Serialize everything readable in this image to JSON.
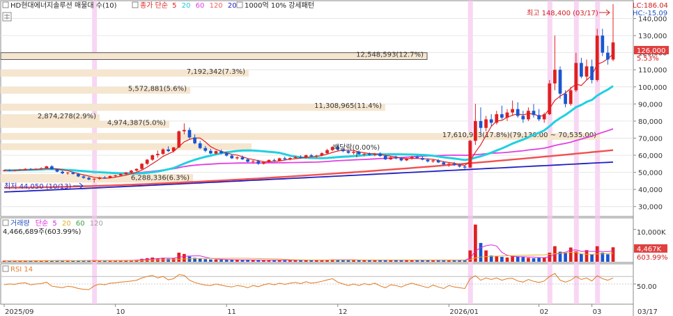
{
  "header": {
    "stock_title": "HD현대에너지솔루션 매물대 수(10)",
    "ma_label": "종가 단순",
    "ma_periods": [
      "5",
      "20",
      "60",
      "120",
      "200"
    ],
    "ma_colors": [
      "#e02020",
      "#20c8d8",
      "#e040e0",
      "#f06060",
      "#2020c0"
    ],
    "vp_label": "1000억 10% 강세패턴",
    "lc_label": "LC:186.04",
    "hc_label": "HC:-15.09"
  },
  "price_axis": {
    "ticks": [
      "140,000",
      "130,000",
      "120,000",
      "110,000",
      "100,000",
      "90,000",
      "80,000",
      "70,000",
      "60,000",
      "50,000",
      "40,000",
      "30,000"
    ],
    "current_price": "126,000",
    "current_change": "5.53%"
  },
  "annotations": {
    "high": "최고 148,400 (03/17)",
    "low": "최저 44,050 (10/13)",
    "dividend": "배당락(0.00%)"
  },
  "volume_panel": {
    "title_prefix": "거래량",
    "ma_label": "단순",
    "ma_periods": [
      "5",
      "20",
      "60",
      "120"
    ],
    "ma_colors": [
      "#e020e0",
      "#e0b020",
      "#40a040",
      "#a0a0a0"
    ],
    "last_volume": "4,466,689주(603.99%)",
    "axis_tick": "10,000K",
    "current_value": "4,467K",
    "current_pct": "603.99%"
  },
  "rsi_panel": {
    "title": "RSI 14",
    "axis_tick": "50.00"
  },
  "x_axis": {
    "labels": [
      "2025/09",
      "10",
      "11",
      "12",
      "2026/01",
      "02",
      "03",
      "03/17"
    ]
  },
  "chart_data": {
    "type": "candlestick",
    "ylim": [
      25000,
      150000
    ],
    "high_point": {
      "value": 148400,
      "date": "03/17"
    },
    "low_point": {
      "value": 44050,
      "date": "10/13"
    },
    "volume_profile": [
      {
        "label": "12,548,593(12.7%)",
        "low": 116000,
        "high": 120000,
        "highlight": true
      },
      {
        "label": "7,192,342(7.3%)",
        "low": 106000,
        "high": 110000
      },
      {
        "label": "5,572,881(5.6%)",
        "low": 96000,
        "high": 100000
      },
      {
        "label": "11,308,965(11.4%)",
        "low": 86000,
        "high": 90000
      },
      {
        "label": "2,874,278(2.9%)",
        "low": 80000,
        "high": 84000
      },
      {
        "label": "4,974,387(5.0%)",
        "low": 76000,
        "high": 80000
      },
      {
        "label": "17,610,923(17.8%)(79,130.00 ~ 70,535.00)",
        "low": 69000,
        "high": 73000
      },
      {
        "label": "",
        "low": 63000,
        "high": 67000
      },
      {
        "label": "6,288,336(6.3%)",
        "low": 44000,
        "high": 49000
      }
    ],
    "candles": [
      [
        51000,
        51500,
        50500,
        51200
      ],
      [
        51200,
        51800,
        50800,
        51000
      ],
      [
        51000,
        51600,
        50600,
        51400
      ],
      [
        51400,
        52000,
        51000,
        51600
      ],
      [
        51600,
        52400,
        51200,
        52000
      ],
      [
        52000,
        52500,
        51500,
        51700
      ],
      [
        51700,
        52300,
        51300,
        52000
      ],
      [
        52000,
        53000,
        51600,
        52400
      ],
      [
        52400,
        53800,
        52000,
        53500
      ],
      [
        53500,
        54200,
        51500,
        51800
      ],
      [
        51800,
        52200,
        50000,
        50400
      ],
      [
        50400,
        51000,
        49000,
        49400
      ],
      [
        49400,
        50200,
        48600,
        49800
      ],
      [
        49800,
        50400,
        48800,
        49000
      ],
      [
        49000,
        49600,
        47200,
        47600
      ],
      [
        47600,
        48200,
        46200,
        46800
      ],
      [
        46800,
        47400,
        45400,
        45800
      ],
      [
        45800,
        46600,
        44050,
        46200
      ],
      [
        46200,
        47400,
        45600,
        47000
      ],
      [
        47000,
        47800,
        46400,
        46800
      ],
      [
        46800,
        48200,
        46400,
        47800
      ],
      [
        47800,
        48600,
        47200,
        48200
      ],
      [
        48200,
        49400,
        47800,
        49000
      ],
      [
        49000,
        50200,
        48400,
        49800
      ],
      [
        49800,
        51400,
        49400,
        51000
      ],
      [
        51000,
        52400,
        50400,
        52000
      ],
      [
        52000,
        55400,
        51600,
        55000
      ],
      [
        55000,
        57800,
        54200,
        57400
      ],
      [
        57400,
        60400,
        56800,
        60000
      ],
      [
        60000,
        62800,
        58600,
        60800
      ],
      [
        60800,
        64200,
        60200,
        63400
      ],
      [
        63400,
        65200,
        61800,
        62400
      ],
      [
        62400,
        64800,
        61600,
        64600
      ],
      [
        64600,
        74400,
        64200,
        74000
      ],
      [
        74000,
        78600,
        72200,
        74800
      ],
      [
        74800,
        76200,
        69400,
        70400
      ],
      [
        70400,
        72200,
        66400,
        67000
      ],
      [
        67000,
        68400,
        63600,
        64200
      ],
      [
        64200,
        65400,
        61800,
        62600
      ],
      [
        62600,
        63800,
        60600,
        61000
      ],
      [
        61000,
        62800,
        60400,
        62400
      ],
      [
        62400,
        63400,
        60600,
        61200
      ],
      [
        61200,
        62000,
        59200,
        59800
      ],
      [
        59800,
        60600,
        57800,
        58200
      ],
      [
        58200,
        59400,
        57400,
        58800
      ],
      [
        58800,
        59800,
        57200,
        57600
      ],
      [
        57600,
        58400,
        55800,
        56200
      ],
      [
        56200,
        57200,
        55000,
        56600
      ],
      [
        56600,
        57400,
        54400,
        55000
      ],
      [
        55000,
        56400,
        54600,
        56000
      ],
      [
        56000,
        57600,
        55600,
        57200
      ],
      [
        57200,
        58000,
        56200,
        56800
      ],
      [
        56800,
        58600,
        56400,
        58200
      ],
      [
        58200,
        59200,
        57000,
        57600
      ],
      [
        57600,
        58800,
        57000,
        58400
      ],
      [
        58400,
        59600,
        57800,
        59000
      ],
      [
        59000,
        60000,
        58000,
        58600
      ],
      [
        58600,
        60400,
        58200,
        60000
      ],
      [
        60000,
        60800,
        58800,
        59400
      ],
      [
        59400,
        60200,
        58400,
        59800
      ],
      [
        59800,
        61800,
        59400,
        61200
      ],
      [
        61200,
        63800,
        60800,
        63000
      ],
      [
        63000,
        65400,
        62400,
        64800
      ],
      [
        64800,
        66000,
        62800,
        63400
      ],
      [
        63400,
        64600,
        61800,
        62400
      ],
      [
        62400,
        63400,
        60800,
        61400
      ],
      [
        61400,
        62600,
        60400,
        62000
      ],
      [
        62000,
        62800,
        60000,
        60600
      ],
      [
        60600,
        61400,
        59400,
        60800
      ],
      [
        60800,
        61600,
        59800,
        60200
      ],
      [
        60200,
        61400,
        59400,
        61000
      ],
      [
        61000,
        61800,
        59000,
        59600
      ],
      [
        59600,
        60400,
        57200,
        57600
      ],
      [
        57600,
        59200,
        57200,
        58800
      ],
      [
        58800,
        59800,
        57600,
        58200
      ],
      [
        58200,
        59000,
        56400,
        57000
      ],
      [
        57000,
        58400,
        56600,
        58000
      ],
      [
        58000,
        59600,
        57400,
        59000
      ],
      [
        59000,
        59800,
        57800,
        58400
      ],
      [
        58400,
        59400,
        57000,
        57400
      ],
      [
        57400,
        58200,
        55800,
        56400
      ],
      [
        56400,
        57600,
        55600,
        57000
      ],
      [
        57000,
        57800,
        55400,
        55800
      ],
      [
        55800,
        56600,
        54000,
        54600
      ],
      [
        54600,
        55600,
        53200,
        55000
      ],
      [
        55000,
        56200,
        53800,
        54200
      ],
      [
        54200,
        55000,
        52800,
        53400
      ],
      [
        53400,
        54200,
        51800,
        52800
      ],
      [
        52800,
        69000,
        52600,
        68400
      ],
      [
        68400,
        90000,
        66000,
        80000
      ],
      [
        80000,
        88000,
        73000,
        76000
      ],
      [
        76000,
        83000,
        74000,
        81000
      ],
      [
        81000,
        84000,
        77000,
        79000
      ],
      [
        79000,
        86000,
        78000,
        84000
      ],
      [
        84000,
        89000,
        81000,
        82000
      ],
      [
        82000,
        87000,
        80000,
        85000
      ],
      [
        85000,
        92000,
        83000,
        87000
      ],
      [
        87000,
        91000,
        82000,
        83000
      ],
      [
        83000,
        86000,
        79000,
        81000
      ],
      [
        81000,
        88000,
        80000,
        86000
      ],
      [
        86000,
        90000,
        82000,
        83500
      ],
      [
        83500,
        87000,
        80000,
        81000
      ],
      [
        81000,
        85000,
        79000,
        84000
      ],
      [
        84000,
        104000,
        83500,
        102000
      ],
      [
        102000,
        130000,
        98000,
        110000
      ],
      [
        110000,
        112000,
        93000,
        96000
      ],
      [
        96000,
        98000,
        88000,
        90000
      ],
      [
        90000,
        100000,
        89000,
        98000
      ],
      [
        98000,
        120000,
        97000,
        114000
      ],
      [
        114000,
        117000,
        105000,
        106000
      ],
      [
        106000,
        116000,
        104000,
        112000
      ],
      [
        112000,
        116000,
        102000,
        104000
      ],
      [
        104000,
        134000,
        103000,
        130000
      ],
      [
        130000,
        134000,
        118000,
        120000
      ],
      [
        120000,
        124000,
        113000,
        116000
      ],
      [
        116000,
        148400,
        115000,
        126000
      ]
    ],
    "volumes": [
      300,
      280,
      310,
      290,
      350,
      320,
      300,
      340,
      400,
      380,
      360,
      340,
      320,
      330,
      380,
      360,
      400,
      450,
      360,
      330,
      380,
      360,
      420,
      460,
      520,
      580,
      900,
      1100,
      1300,
      1000,
      1200,
      900,
      1000,
      2800,
      2400,
      1600,
      1200,
      1000,
      800,
      700,
      650,
      600,
      580,
      560,
      550,
      540,
      520,
      500,
      480,
      460,
      470,
      460,
      480,
      500,
      490,
      480,
      470,
      500,
      520,
      490,
      480,
      600,
      700,
      620,
      560,
      520,
      500,
      480,
      460,
      470,
      480,
      460,
      520,
      500,
      480,
      460,
      450,
      470,
      480,
      460,
      470,
      460,
      480,
      500,
      470,
      480,
      500,
      520,
      3500,
      11500,
      5800,
      3500,
      1900,
      1700,
      1500,
      1300,
      1800,
      1600,
      1400,
      1200,
      1100,
      1200,
      1300,
      2800,
      4800,
      3100,
      2800,
      4400,
      3200,
      2400,
      3600,
      2200,
      4800,
      2800,
      2300,
      4467
    ],
    "rsi": [
      48,
      50,
      49,
      52,
      53,
      48,
      50,
      51,
      55,
      44,
      42,
      40,
      44,
      42,
      38,
      36,
      35,
      45,
      50,
      48,
      52,
      53,
      55,
      56,
      58,
      60,
      66,
      70,
      73,
      66,
      70,
      61,
      64,
      75,
      73,
      60,
      54,
      50,
      47,
      46,
      50,
      47,
      44,
      42,
      46,
      44,
      40,
      46,
      43,
      48,
      51,
      48,
      52,
      49,
      52,
      54,
      51,
      56,
      52,
      54,
      57,
      61,
      64,
      55,
      50,
      46,
      50,
      46,
      51,
      48,
      52,
      45,
      40,
      48,
      46,
      42,
      48,
      52,
      48,
      44,
      40,
      47,
      42,
      38,
      46,
      42,
      40,
      38,
      64,
      72,
      60,
      66,
      62,
      66,
      60,
      64,
      65,
      58,
      55,
      62,
      57,
      54,
      58,
      70,
      78,
      60,
      55,
      60,
      70,
      62,
      66,
      58,
      72,
      64,
      60,
      66
    ],
    "rsi_ylim": [
      0,
      100
    ],
    "highlight_bar_indices": [
      17,
      88,
      103,
      108,
      112
    ]
  }
}
